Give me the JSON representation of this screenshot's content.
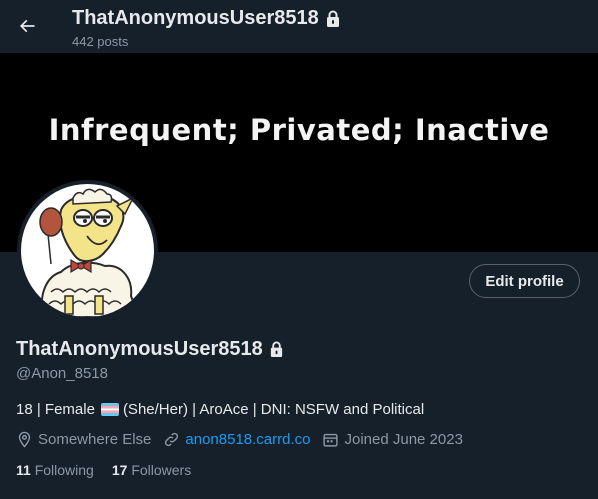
{
  "header": {
    "display_name": "ThatAnonymousUser8518",
    "posts_count": "442 posts"
  },
  "banner": {
    "text": "Infrequent; Privated; Inactive"
  },
  "actions": {
    "edit_profile_label": "Edit profile"
  },
  "profile": {
    "display_name": "ThatAnonymousUser8518",
    "handle": "@Anon_8518",
    "bio_before_flag": "18 | Female",
    "bio_after_flag": "(She/Her) | AroAce | DNI: NSFW and Political",
    "location": "Somewhere Else",
    "website": "anon8518.carrd.co",
    "joined": "Joined June 2023"
  },
  "stats": {
    "following_count": "11",
    "following_label": "Following",
    "followers_count": "17",
    "followers_label": "Followers"
  },
  "colors": {
    "background": "#15202b",
    "link": "#1d9bf0",
    "secondary_text": "#8b98a5"
  },
  "icons": [
    "back-arrow-icon",
    "lock-icon",
    "location-pin-icon",
    "link-icon",
    "calendar-icon",
    "transgender-flag-icon"
  ]
}
